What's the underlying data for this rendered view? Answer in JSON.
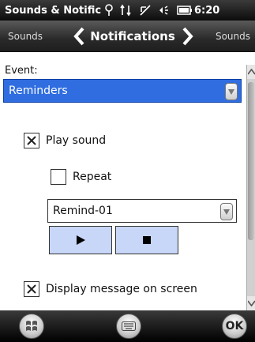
{
  "titlebar": {
    "title": "Sounds & Notificat",
    "time": "6:20",
    "icons": [
      "signal-icon",
      "data-arrows-icon",
      "phone-icon",
      "speaker-icon",
      "battery-icon"
    ]
  },
  "navbar": {
    "prev_label": "Sounds",
    "current_label": "Notifications",
    "next_label": "Sounds"
  },
  "content": {
    "event_label": "Event:",
    "event_value": "Reminders",
    "play_sound_label": "Play sound",
    "play_sound_checked": true,
    "repeat_label": "Repeat",
    "repeat_checked": false,
    "sound_value": "Remind-01",
    "display_message_label": "Display message on screen",
    "display_message_checked": true
  },
  "bottombar": {
    "ok_label": "OK"
  },
  "colors": {
    "selection": "#2f6de0",
    "media_button": "#c8d6f8"
  }
}
